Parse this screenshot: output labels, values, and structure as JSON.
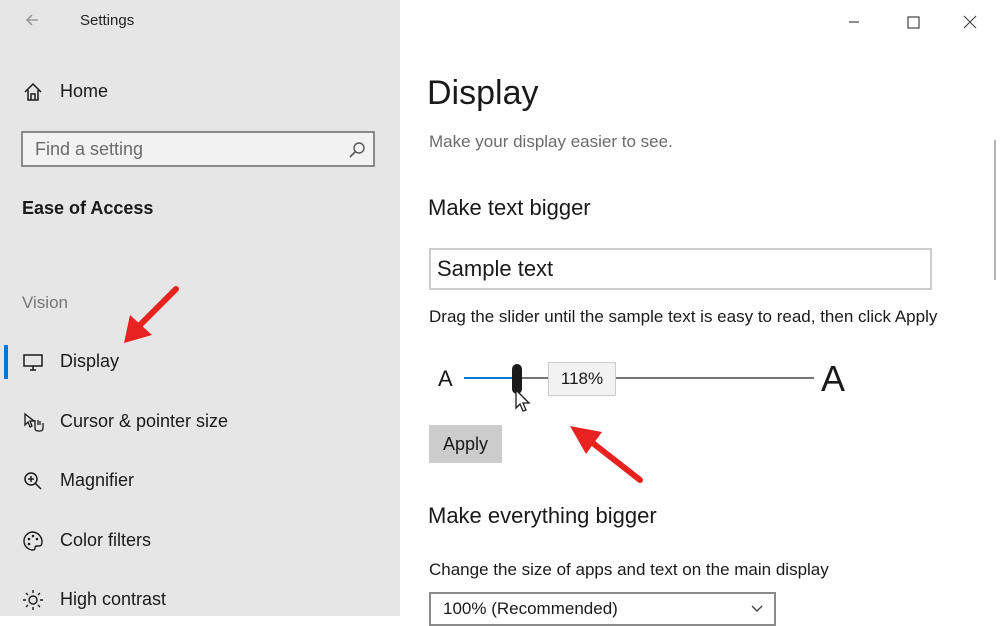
{
  "window": {
    "title": "Settings"
  },
  "sidebar": {
    "home_label": "Home",
    "search": {
      "placeholder": "Find a setting"
    },
    "section_title": "Ease of Access",
    "group_label": "Vision",
    "items": [
      {
        "label": "Display",
        "icon": "monitor-icon",
        "selected": true
      },
      {
        "label": "Cursor & pointer size",
        "icon": "cursor-pointer-icon"
      },
      {
        "label": "Magnifier",
        "icon": "magnifier-icon"
      },
      {
        "label": "Color filters",
        "icon": "palette-icon"
      },
      {
        "label": "High contrast",
        "icon": "sun-icon"
      }
    ]
  },
  "main": {
    "title": "Display",
    "subtitle": "Make your display easier to see.",
    "text_bigger": {
      "heading": "Make text bigger",
      "sample": "Sample text",
      "instruction": "Drag the slider until the sample text is easy to read, then click Apply",
      "small_a": "A",
      "big_a": "A",
      "slider_value": "118%",
      "slider_fraction": 0.15,
      "apply_label": "Apply"
    },
    "everything_bigger": {
      "heading": "Make everything bigger",
      "instruction": "Change the size of apps and text on the main display",
      "selected": "100% (Recommended)"
    }
  },
  "colors": {
    "accent": "#0078d7",
    "sidebar_bg": "#e6e6e6",
    "annotation_arrow": "#e8231f"
  }
}
